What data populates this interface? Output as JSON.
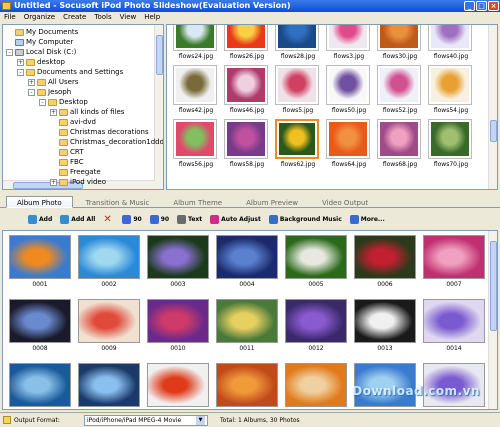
{
  "window": {
    "title": "Untitled - Socusoft iPod Photo Slideshow(Evaluation Version)"
  },
  "menu": [
    "File",
    "Organize",
    "Create",
    "Tools",
    "View",
    "Help"
  ],
  "tree": [
    {
      "label": "My Documents",
      "icon": "my-documents",
      "indent": 0,
      "expander": ""
    },
    {
      "label": "My Computer",
      "icon": "my-computer",
      "indent": 0,
      "expander": ""
    },
    {
      "label": "Local Disk (C:)",
      "icon": "disk",
      "indent": 0,
      "expander": "-"
    },
    {
      "label": "desktop",
      "icon": "folder",
      "indent": 1,
      "expander": "+"
    },
    {
      "label": "Documents and Settings",
      "icon": "folder",
      "indent": 1,
      "expander": "-"
    },
    {
      "label": "All Users",
      "icon": "folder",
      "indent": 2,
      "expander": "+"
    },
    {
      "label": "Jesoph",
      "icon": "folder",
      "indent": 2,
      "expander": "-"
    },
    {
      "label": "Desktop",
      "icon": "folder",
      "indent": 3,
      "expander": "-"
    },
    {
      "label": "all kinds of files",
      "icon": "folder",
      "indent": 4,
      "expander": "+"
    },
    {
      "label": "avi-dvd",
      "icon": "folder",
      "indent": 4,
      "expander": ""
    },
    {
      "label": "Christmas decorations",
      "icon": "folder",
      "indent": 4,
      "expander": ""
    },
    {
      "label": "Christmas_decoration1ddd",
      "icon": "folder",
      "indent": 4,
      "expander": ""
    },
    {
      "label": "CRT",
      "icon": "folder",
      "indent": 4,
      "expander": ""
    },
    {
      "label": "FBC",
      "icon": "folder",
      "indent": 4,
      "expander": ""
    },
    {
      "label": "Freegate",
      "icon": "folder",
      "indent": 4,
      "expander": ""
    },
    {
      "label": "iPod video",
      "icon": "folder",
      "indent": 4,
      "expander": "+"
    }
  ],
  "files": [
    {
      "name": "flows24.jpg",
      "colors": [
        "#3a7a2a",
        "#d8e8f0"
      ]
    },
    {
      "name": "flows26.jpg",
      "colors": [
        "#e83a1a",
        "#f8d040"
      ]
    },
    {
      "name": "flows28.jpg",
      "colors": [
        "#1a4a8a",
        "#3070c0"
      ]
    },
    {
      "name": "flows3.jpg",
      "colors": [
        "#f0e8f0",
        "#e04a8a"
      ]
    },
    {
      "name": "flows30.jpg",
      "colors": [
        "#c05a1a",
        "#e89040"
      ]
    },
    {
      "name": "flows40.jpg",
      "colors": [
        "#e8e8f8",
        "#a070c0"
      ]
    },
    {
      "name": "flows42.jpg",
      "colors": [
        "#f0f0f0",
        "#7a6a3a"
      ]
    },
    {
      "name": "flows46.jpg",
      "colors": [
        "#b03a6a",
        "#f0d0e0"
      ]
    },
    {
      "name": "flows5.jpg",
      "colors": [
        "#f0e0e8",
        "#d04060"
      ]
    },
    {
      "name": "flows50.jpg",
      "colors": [
        "#f8f8f8",
        "#7050a0"
      ]
    },
    {
      "name": "flows52.jpg",
      "colors": [
        "#f0f0f8",
        "#d05090"
      ]
    },
    {
      "name": "flows54.jpg",
      "colors": [
        "#f8f0e0",
        "#e8a030"
      ]
    },
    {
      "name": "flows56.jpg",
      "colors": [
        "#e04a6a",
        "#80c060"
      ]
    },
    {
      "name": "flows58.jpg",
      "colors": [
        "#7a3a8a",
        "#c050a0"
      ]
    },
    {
      "name": "flows62.jpg",
      "colors": [
        "#2a5a1a",
        "#f0c020"
      ],
      "selected": true
    },
    {
      "name": "flows64.jpg",
      "colors": [
        "#e85a1a",
        "#f09040"
      ]
    },
    {
      "name": "flows68.jpg",
      "colors": [
        "#a04a8a",
        "#f0a0c0"
      ]
    },
    {
      "name": "flows70.jpg",
      "colors": [
        "#3a6a2a",
        "#a0c070"
      ]
    }
  ],
  "tabs": [
    "Album Photo",
    "Transition & Music",
    "Album Theme",
    "Album Preview",
    "Video Output"
  ],
  "active_tab": 0,
  "toolbar": [
    {
      "label": "Add",
      "icon": "add-icon",
      "color": "#3a8ad0"
    },
    {
      "label": "Add All",
      "icon": "add-all-icon",
      "color": "#3a8ad0"
    },
    {
      "label": "",
      "icon": "delete-icon",
      "color": "#d02020"
    },
    {
      "label": "90",
      "icon": "rotate-left-icon",
      "color": "#3a6ad0"
    },
    {
      "label": "90",
      "icon": "rotate-right-icon",
      "color": "#3a6ad0"
    },
    {
      "label": "Text",
      "icon": "text-icon",
      "color": "#6a6a6a"
    },
    {
      "label": "Auto Adjust",
      "icon": "auto-adjust-icon",
      "color": "#d02a8a"
    },
    {
      "label": "Background Music",
      "icon": "music-icon",
      "color": "#3a6ad0"
    },
    {
      "label": "More...",
      "icon": "more-icon",
      "color": "#3a6ad0"
    }
  ],
  "album": [
    {
      "num": "0001",
      "colors": [
        "#3a7ad0",
        "#f08a20"
      ]
    },
    {
      "num": "0002",
      "colors": [
        "#2a8ad8",
        "#a0d8f0"
      ]
    },
    {
      "num": "0003",
      "colors": [
        "#1a3a1a",
        "#8a70d0"
      ]
    },
    {
      "num": "0004",
      "colors": [
        "#1a2a6a",
        "#5a80d0"
      ]
    },
    {
      "num": "0005",
      "colors": [
        "#2a6a1a",
        "#e8e8e0"
      ]
    },
    {
      "num": "0006",
      "colors": [
        "#2a3a1a",
        "#c02030"
      ]
    },
    {
      "num": "0007",
      "colors": [
        "#c03070",
        "#f0a0c0"
      ]
    },
    {
      "num": "0008",
      "colors": [
        "#1a1a2a",
        "#6a8ad0"
      ]
    },
    {
      "num": "0009",
      "colors": [
        "#f0e0d0",
        "#e04a3a"
      ]
    },
    {
      "num": "0010",
      "colors": [
        "#6a2a8a",
        "#d03a6a"
      ]
    },
    {
      "num": "0011",
      "colors": [
        "#4a7a3a",
        "#e8d060"
      ]
    },
    {
      "num": "0012",
      "colors": [
        "#3a2a6a",
        "#8a5ad0"
      ]
    },
    {
      "num": "0013",
      "colors": [
        "#1a1a1a",
        "#f0f0f0"
      ]
    },
    {
      "num": "0014",
      "colors": [
        "#e0d8f0",
        "#7a5ad0"
      ]
    },
    {
      "num": "",
      "colors": [
        "#1a5a9a",
        "#8ac0e8"
      ]
    },
    {
      "num": "",
      "colors": [
        "#1a3a6a",
        "#8ac0f0"
      ]
    },
    {
      "num": "",
      "colors": [
        "#f0f0f0",
        "#e03a1a"
      ]
    },
    {
      "num": "",
      "colors": [
        "#c04a1a",
        "#f09a3a"
      ]
    },
    {
      "num": "",
      "colors": [
        "#e07a1a",
        "#f0d0a0"
      ]
    },
    {
      "num": "",
      "colors": [
        "#3a7ad0",
        "#a0d0f0"
      ]
    },
    {
      "num": "",
      "colors": [
        "#e8e8f0",
        "#7a5ad0"
      ]
    }
  ],
  "status": {
    "label": "Output Format:",
    "format": "iPod/iPhone/iPad MPEG-4 Movie",
    "total": "Total: 1 Albums, 30 Photos"
  },
  "watermark": "Download.com.vn"
}
